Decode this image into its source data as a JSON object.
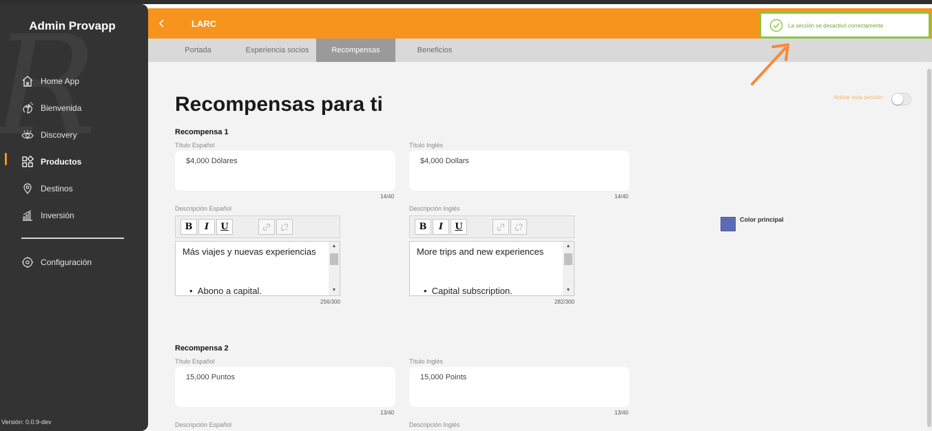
{
  "app": {
    "brand": "Admin Provapp",
    "version": "Versión: 0.0.9-dev",
    "watermark": "R"
  },
  "sidebar": {
    "items": [
      {
        "label": "Home App",
        "icon": "home-icon"
      },
      {
        "label": "Bienvenida",
        "icon": "waving-hand-icon"
      },
      {
        "label": "Discovery",
        "icon": "eye-icon"
      },
      {
        "label": "Productos",
        "icon": "grid-icon",
        "active": true
      },
      {
        "label": "Destinos",
        "icon": "location-pin-icon"
      },
      {
        "label": "Inversión",
        "icon": "bar-chart-icon"
      }
    ],
    "settings": {
      "label": "Configuración",
      "icon": "settings-icon"
    }
  },
  "header": {
    "title": "LARC",
    "back_icon": "chevron-left-icon"
  },
  "tabs": [
    {
      "label": "Portada"
    },
    {
      "label": "Experiencia socios"
    },
    {
      "label": "Recompensas",
      "active": true
    },
    {
      "label": "Beneficios"
    }
  ],
  "page": {
    "title": "Recompensas para ti",
    "toggle_label": "Activar esta sección",
    "toggle_on": false
  },
  "rewards": [
    {
      "title": "Recompensa 1",
      "title_es_label": "Título Español",
      "title_es_value": "$4,000 Dólares",
      "title_es_count": "14/40",
      "title_en_label": "Título Inglés",
      "title_en_value": "$4,000 Dollars",
      "title_en_count": "14/40",
      "desc_es_label": "Descripción Español",
      "desc_es_text": "Más viajes y nuevas experiencias",
      "desc_es_bullet": "Abono a capital.",
      "desc_es_count": "256/300",
      "desc_en_label": "Descripción Inglés",
      "desc_en_text": "More trips and new experiences",
      "desc_en_bullet": "Capital subscription.",
      "desc_en_count": "282/300"
    },
    {
      "title": "Recompensa 2",
      "title_es_label": "Título Español",
      "title_es_value": "15,000 Puntos",
      "title_es_count": "13/40",
      "title_en_label": "Título Inglés",
      "title_en_value": "15,000 Points",
      "title_en_count": "13/40",
      "desc_es_label": "Descripción Español",
      "desc_en_label": "Descripción Inglés"
    }
  ],
  "editor_toolbar": {
    "bold": "B",
    "italic": "I",
    "underline": "U",
    "link_icon": "link-icon",
    "unlink_icon": "unlink-icon"
  },
  "color": {
    "label": "Color principal",
    "value": "#5b6bb5"
  },
  "toast": {
    "message": "La sección se desactivó correctamente",
    "icon": "check-circle-icon"
  },
  "colors": {
    "accent": "#f7941d",
    "sidebar": "#333333",
    "success": "#8cc63f"
  }
}
